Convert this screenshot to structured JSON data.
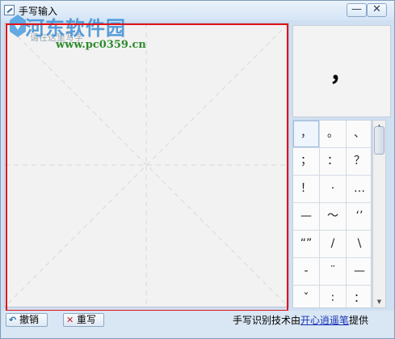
{
  "window": {
    "title": "手写输入",
    "minimize_glyph": "—",
    "close_glyph": "✕"
  },
  "watermark": {
    "logo_text": "河东软件园",
    "url": "www.pc0359.cn"
  },
  "writing_pad": {
    "hint": "请在这里写字"
  },
  "candidate": {
    "top": "，"
  },
  "symbols": [
    "，",
    "。",
    "、",
    "；",
    "：",
    "？",
    "！",
    "·",
    "…",
    "—",
    "～",
    "‘’",
    "“”",
    "/",
    "\\",
    "-",
    "¨",
    "—",
    "ˇ",
    "∶",
    "："
  ],
  "toolbar": {
    "undo_label": "撤销",
    "undo_icon": "undo-arrow-icon",
    "rewrite_label": "重写",
    "rewrite_icon": "x-icon"
  },
  "credit": {
    "prefix": "手写识别技术由",
    "link": "开心逍遥笔",
    "suffix": "提供"
  },
  "colors": {
    "highlight_frame": "#e0121b",
    "link": "#1a35b8"
  }
}
